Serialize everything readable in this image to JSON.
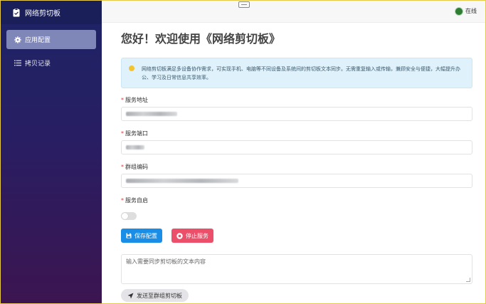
{
  "sidebar": {
    "app_title": "网络剪切板",
    "items": [
      {
        "label": "应用配置",
        "icon": "gear-icon",
        "active": true
      },
      {
        "label": "拷贝记录",
        "icon": "list-icon",
        "active": false
      }
    ]
  },
  "topbar": {
    "status_text": "在线",
    "status_color": "#2e7d32"
  },
  "main": {
    "title": "您好！欢迎使用《网络剪切板》",
    "notice": "网络剪切板满足多设备协作需求，可实现手机、电脑等不同设备及系统间的剪切板文本同步。无需重复输入或传输，兼顾安全与便捷，大幅提升办公、学习及日常信息共享效率。",
    "fields": [
      {
        "label": "服务地址",
        "required": true
      },
      {
        "label": "服务端口",
        "required": true
      },
      {
        "label": "群组编码",
        "required": true
      },
      {
        "label": "服务自启",
        "required": true
      }
    ],
    "autostart_on": false,
    "save_label": "保存配置",
    "stop_label": "停止服务",
    "textarea_placeholder": "输入需要同步剪切板的文本内容",
    "send_label": "发送至群组剪切板"
  },
  "colors": {
    "save_button": "#1a8ee6",
    "stop_button": "#ec4f6a",
    "sidebar_top": "#1d2466",
    "sidebar_bottom": "#3c1550"
  }
}
